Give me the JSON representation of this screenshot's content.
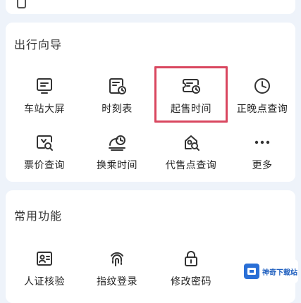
{
  "travel_guide": {
    "title": "出行向导",
    "items": [
      {
        "label": "车站大屏",
        "icon": "station-screen-icon"
      },
      {
        "label": "时刻表",
        "icon": "timetable-icon"
      },
      {
        "label": "起售时间",
        "icon": "sale-time-icon"
      },
      {
        "label": "正晚点查询",
        "icon": "clock-icon"
      },
      {
        "label": "票价查询",
        "icon": "fare-query-icon"
      },
      {
        "label": "换乘时间",
        "icon": "transfer-time-icon"
      },
      {
        "label": "代售点查询",
        "icon": "agency-search-icon"
      },
      {
        "label": "更多",
        "icon": "more-icon"
      }
    ],
    "highlighted": "起售时间"
  },
  "common_functions": {
    "title": "常用功能",
    "items": [
      {
        "label": "人证核验",
        "icon": "id-verify-icon"
      },
      {
        "label": "指纹登录",
        "icon": "fingerprint-icon"
      },
      {
        "label": "修改密码",
        "icon": "lock-icon"
      }
    ]
  },
  "watermark": {
    "text": "神奇下载站"
  },
  "colors": {
    "highlight_border": "#d9475f",
    "background": "#eef3fa",
    "card": "#ffffff",
    "icon_stroke": "#333333",
    "watermark_text": "#1f5fbf"
  }
}
